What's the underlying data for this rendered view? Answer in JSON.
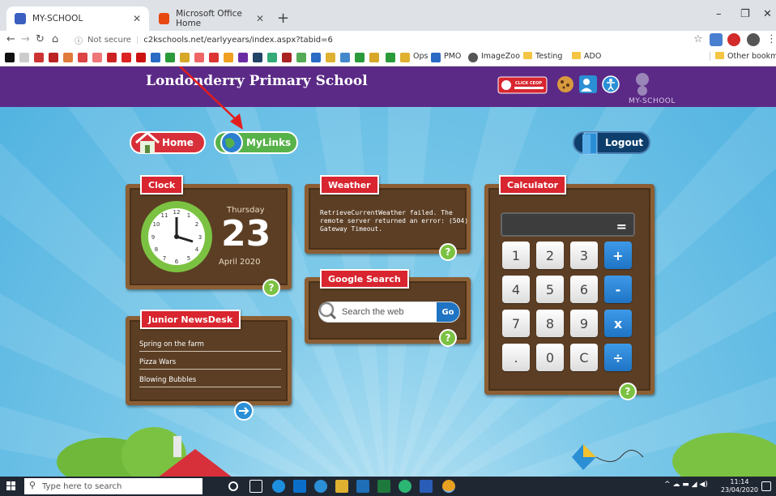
{
  "browser": {
    "tabs": [
      {
        "title": "MY-SCHOOL",
        "active": true
      },
      {
        "title": "Microsoft Office Home",
        "active": false
      }
    ],
    "address": {
      "security": "Not secure",
      "url": "c2kschools.net/earlyyears/index.aspx?tabid=6"
    },
    "bookmarks": [
      {
        "label": "Ops"
      },
      {
        "label": "PMO"
      },
      {
        "label": "ImageZoo"
      },
      {
        "label": "Testing"
      },
      {
        "label": "ADO"
      },
      {
        "label": "Other bookmarks"
      }
    ]
  },
  "site": {
    "school_name": "Londonderry Primary School",
    "click_ceop_label": "CLICK CEOP",
    "brand": "MY-SCHOOL",
    "nav": {
      "home": "Home",
      "mylinks": "MyLinks",
      "logout": "Logout"
    }
  },
  "clock": {
    "title": "Clock",
    "day": "Thursday",
    "date": "23",
    "month": "April 2020",
    "help": "?"
  },
  "weather": {
    "title": "Weather",
    "message": "RetrieveCurrentWeather failed. The remote server returned an error: (504) Gateway Timeout.",
    "help": "?"
  },
  "search": {
    "title": "Google Search",
    "placeholder": "Search the web",
    "go": "Go",
    "help": "?"
  },
  "news": {
    "title": "Junior NewsDesk",
    "items": [
      "Spring on the farm",
      "Pizza Wars",
      "Blowing Bubbles"
    ]
  },
  "calculator": {
    "title": "Calculator",
    "equals": "=",
    "keys": [
      "1",
      "2",
      "3",
      "+",
      "4",
      "5",
      "6",
      "-",
      "7",
      "8",
      "9",
      "x",
      ".",
      "0",
      "C",
      "÷"
    ],
    "help": "?"
  },
  "taskbar": {
    "search_placeholder": "Type here to search",
    "time": "11:14",
    "date": "23/04/2020"
  },
  "colors": {
    "header_purple": "#5b2a86",
    "tag_red": "#d8252f",
    "home_red": "#d8303a",
    "mylinks_green": "#58b24a",
    "logout_navy": "#0e3f6c",
    "sky": "#4fb2e0"
  }
}
